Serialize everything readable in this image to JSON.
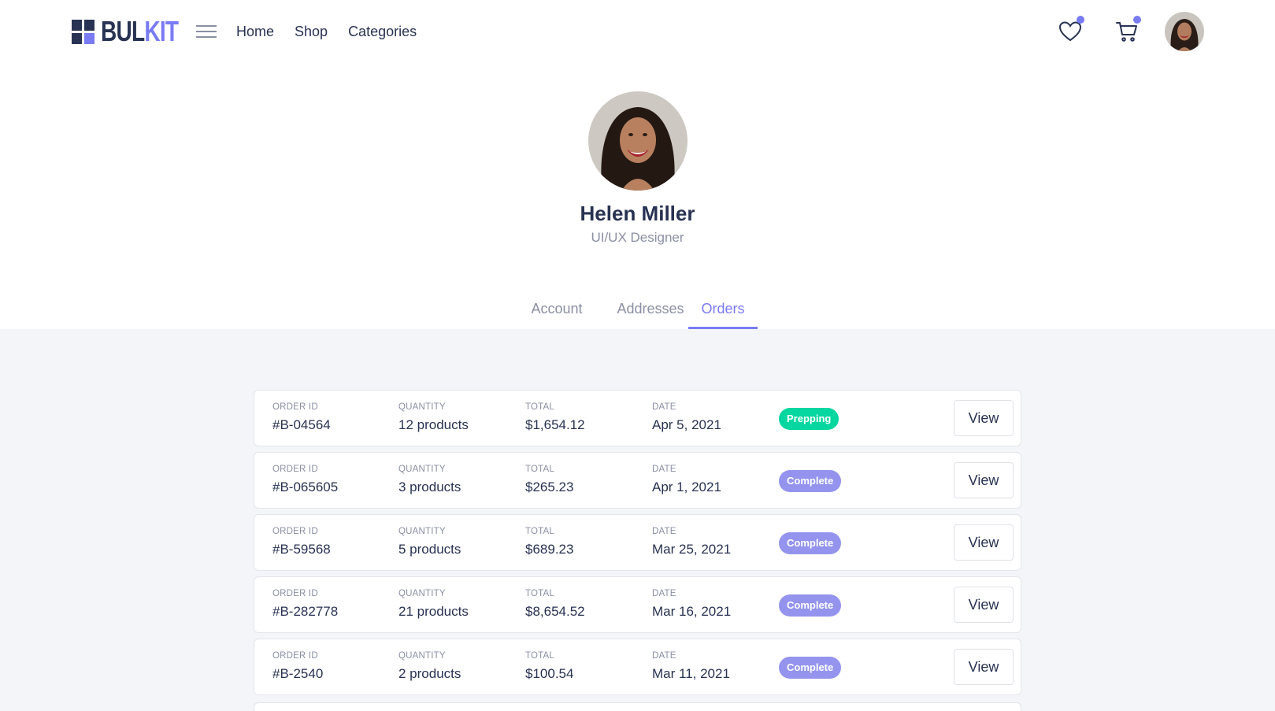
{
  "brand": {
    "part1": "BUL",
    "part2": "KIT",
    "accent": "#797bf2",
    "dark": "#283252"
  },
  "nav": {
    "links": [
      "Home",
      "Shop",
      "Categories"
    ],
    "icons": [
      "heart-icon",
      "cart-icon"
    ]
  },
  "profile": {
    "name": "Helen Miller",
    "role": "UI/UX Designer"
  },
  "tabs": [
    {
      "label": "Account",
      "active": false
    },
    {
      "label": "Addresses",
      "active": false
    },
    {
      "label": "Orders",
      "active": true
    }
  ],
  "orders": [
    {
      "order_id": "#B-04564",
      "quantity": "12 products",
      "total": "$1,654.12",
      "date": "Apr 5, 2021",
      "status": "Prepping",
      "action": "View"
    },
    {
      "order_id": "#B-065605",
      "quantity": "3 products",
      "total": "$265.23",
      "date": "Apr 1, 2021",
      "status": "Complete",
      "action": "View"
    },
    {
      "order_id": "#B-59568",
      "quantity": "5 products",
      "total": "$689.23",
      "date": "Mar 25, 2021",
      "status": "Complete",
      "action": "View"
    },
    {
      "order_id": "#B-282778",
      "quantity": "21 products",
      "total": "$8,654.52",
      "date": "Mar 16, 2021",
      "status": "Complete",
      "action": "View"
    },
    {
      "order_id": "#B-2540",
      "quantity": "2 products",
      "total": "$100.54",
      "date": "Mar 11, 2021",
      "status": "Complete",
      "action": "View"
    }
  ],
  "labels": {
    "order_id": "Order ID",
    "quantity": "Quantity",
    "total": "Total",
    "date": "Date"
  },
  "status_colors": {
    "Prepping": "#06d6a0",
    "Complete": "#9494ee"
  }
}
